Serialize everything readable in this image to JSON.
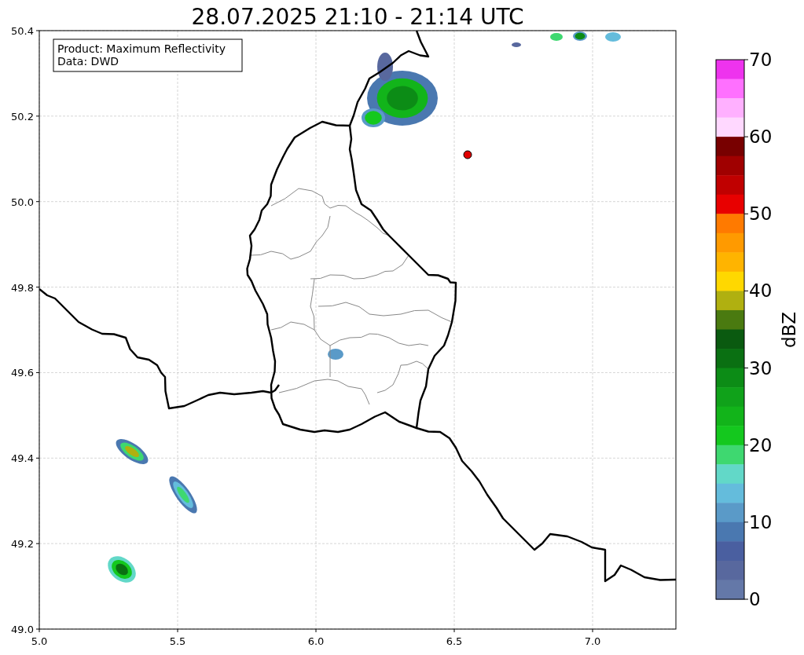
{
  "title": "28.07.2025 21:10 - 21:14 UTC",
  "info_box": [
    "Product: Maximum Reflectivity",
    "Data: DWD"
  ],
  "x_axis": {
    "ticks": [
      "5.0",
      "5.5",
      "6.0",
      "6.5",
      "7.0"
    ]
  },
  "y_axis": {
    "ticks": [
      "50.4",
      "50.2",
      "50.0",
      "49.8",
      "49.6",
      "49.4",
      "49.2",
      "49.0"
    ]
  },
  "colorbar": {
    "label": "dBZ",
    "ticks": [
      "70",
      "60",
      "50",
      "40",
      "30",
      "20",
      "10",
      "0"
    ],
    "bands": [
      {
        "color": "#ee33ee"
      },
      {
        "color": "#ff70ff"
      },
      {
        "color": "#ffb0ff"
      },
      {
        "color": "#ffd8ff"
      },
      {
        "color": "#780000"
      },
      {
        "color": "#a00000"
      },
      {
        "color": "#c00000"
      },
      {
        "color": "#e80000"
      },
      {
        "color": "#ff7a00"
      },
      {
        "color": "#ff9a00"
      },
      {
        "color": "#ffb400"
      },
      {
        "color": "#ffd800"
      },
      {
        "color": "#b0b010"
      },
      {
        "color": "#4a7a10"
      },
      {
        "color": "#0a5a10"
      },
      {
        "color": "#0a7012"
      },
      {
        "color": "#0c8c16"
      },
      {
        "color": "#10a21a"
      },
      {
        "color": "#12b41a"
      },
      {
        "color": "#14c81e"
      },
      {
        "color": "#3ed870"
      },
      {
        "color": "#62d8c8"
      },
      {
        "color": "#64bcdc"
      },
      {
        "color": "#5a9ac8"
      },
      {
        "color": "#4a78b0"
      },
      {
        "color": "#4a5fa0"
      },
      {
        "color": "#58689e"
      },
      {
        "color": "#6478a8"
      }
    ]
  }
}
